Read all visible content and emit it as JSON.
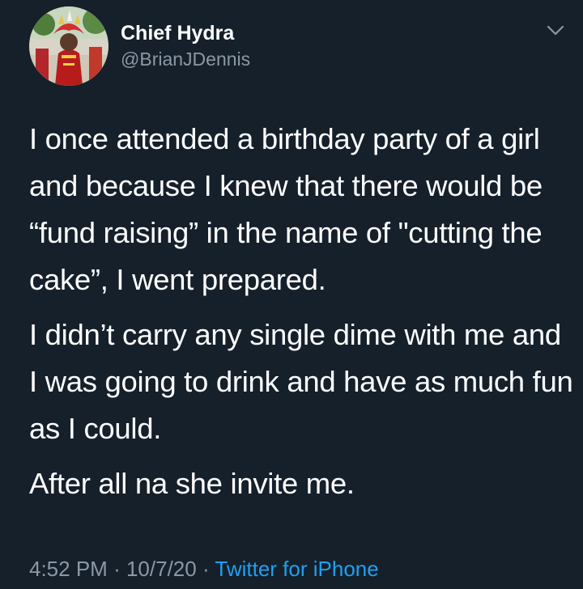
{
  "user": {
    "display_name": "Chief Hydra",
    "handle": "@BrianJDennis"
  },
  "icons": {
    "avatar": "profile-photo",
    "menu": "chevron-down-icon"
  },
  "tweet": {
    "paragraphs": [
      "I once attended a birthday party of a girl and because I knew that there would be “fund raising” in the name of \"cutting the cake”, I went prepared.",
      "I didn’t carry any single dime with me and I was going to drink and have as much fun as I could.",
      "After all na she invite me."
    ]
  },
  "meta": {
    "time": "4:52 PM",
    "separator": "·",
    "date": "10/7/20",
    "source": "Twitter for iPhone"
  },
  "colors": {
    "background": "#15202b",
    "text": "#ffffff",
    "secondary_text": "#8b98a5",
    "link": "#1da1f2"
  }
}
